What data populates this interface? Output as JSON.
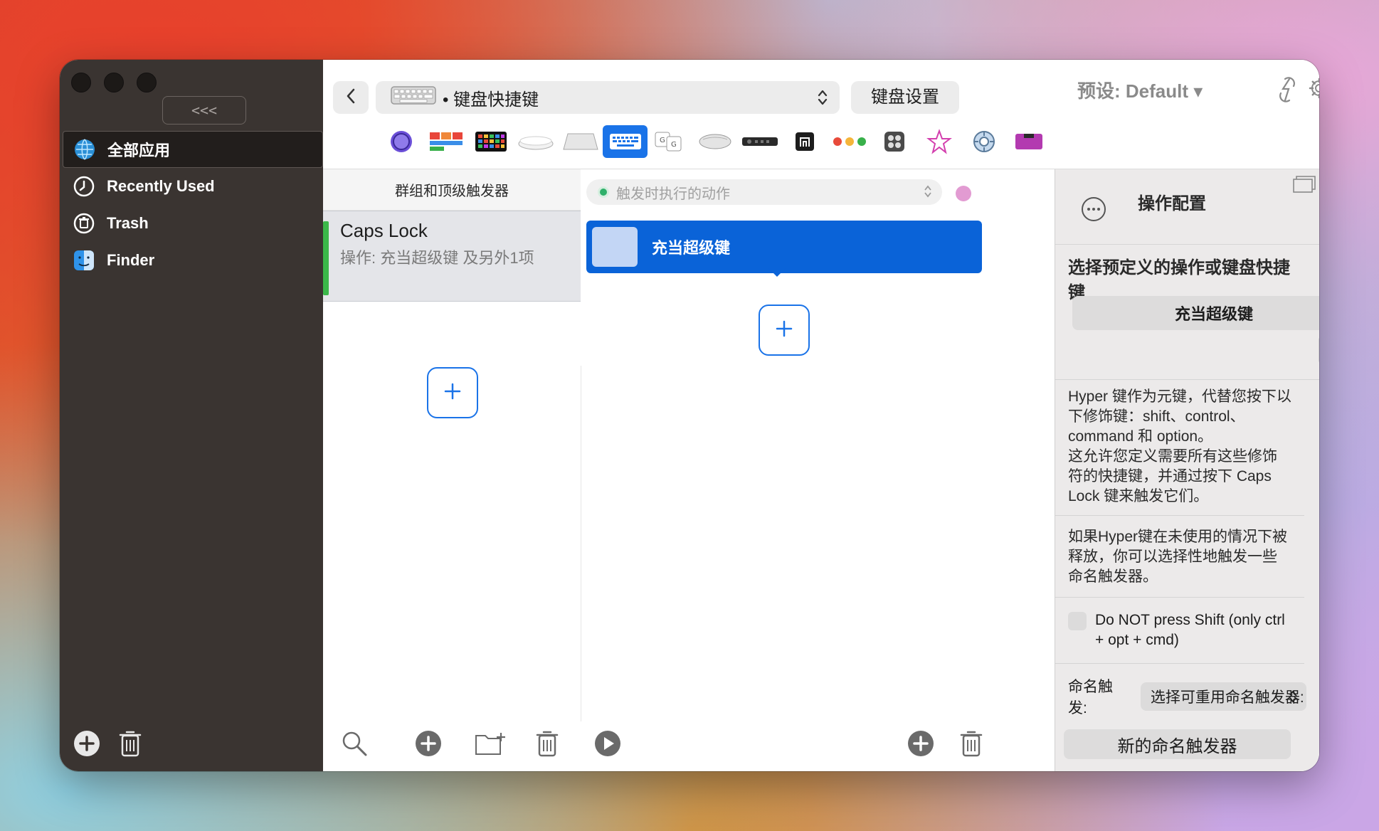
{
  "sidebar": {
    "collapse_label": "<<<",
    "items": [
      {
        "label": "全部应用",
        "icon": "globe-icon",
        "active": true
      },
      {
        "label": "Recently Used",
        "icon": "clock-icon",
        "active": false
      },
      {
        "label": "Trash",
        "icon": "trash-icon",
        "active": false
      },
      {
        "label": "Finder",
        "icon": "finder-icon",
        "active": false
      }
    ]
  },
  "toolbar": {
    "preset_select_label": "• 键盘快捷键",
    "keyboard_settings_label": "键盘设置",
    "preset_label": "预设: Default ▾"
  },
  "groups": {
    "header": "群组和顶级触发器",
    "trigger": {
      "title": "Caps Lock",
      "subtitle": "操作: 充当超级键 及另外1项"
    }
  },
  "actions": {
    "select_placeholder": "触发时执行的动作",
    "item_label": "充当超级键"
  },
  "config": {
    "title": "操作配置",
    "section_title": "选择预定义的操作或键盘快捷键",
    "dropdown_value": "充当超级键",
    "description1": "Hyper 键作为元键，代替您按下以下修饰键：shift、control、command 和 option。\n这允许您定义需要所有这些修饰符的快捷键，并通过按下 Caps Lock 键来触发它们。",
    "description2": "如果Hyper键在未使用的情况下被释放，你可以选择性地触发一些命名触发器。",
    "checkbox_label": "Do NOT press Shift (only ctrl + opt + cmd)",
    "named_trigger_label": "命名触发:",
    "named_trigger_select": "选择可重用命名触发器:",
    "new_named_trigger": "新的命名触发器"
  },
  "colors": {
    "accent": "#0a63d8",
    "sidebar_bg": "#3a3431",
    "trigger_green": "#3bb84a"
  }
}
